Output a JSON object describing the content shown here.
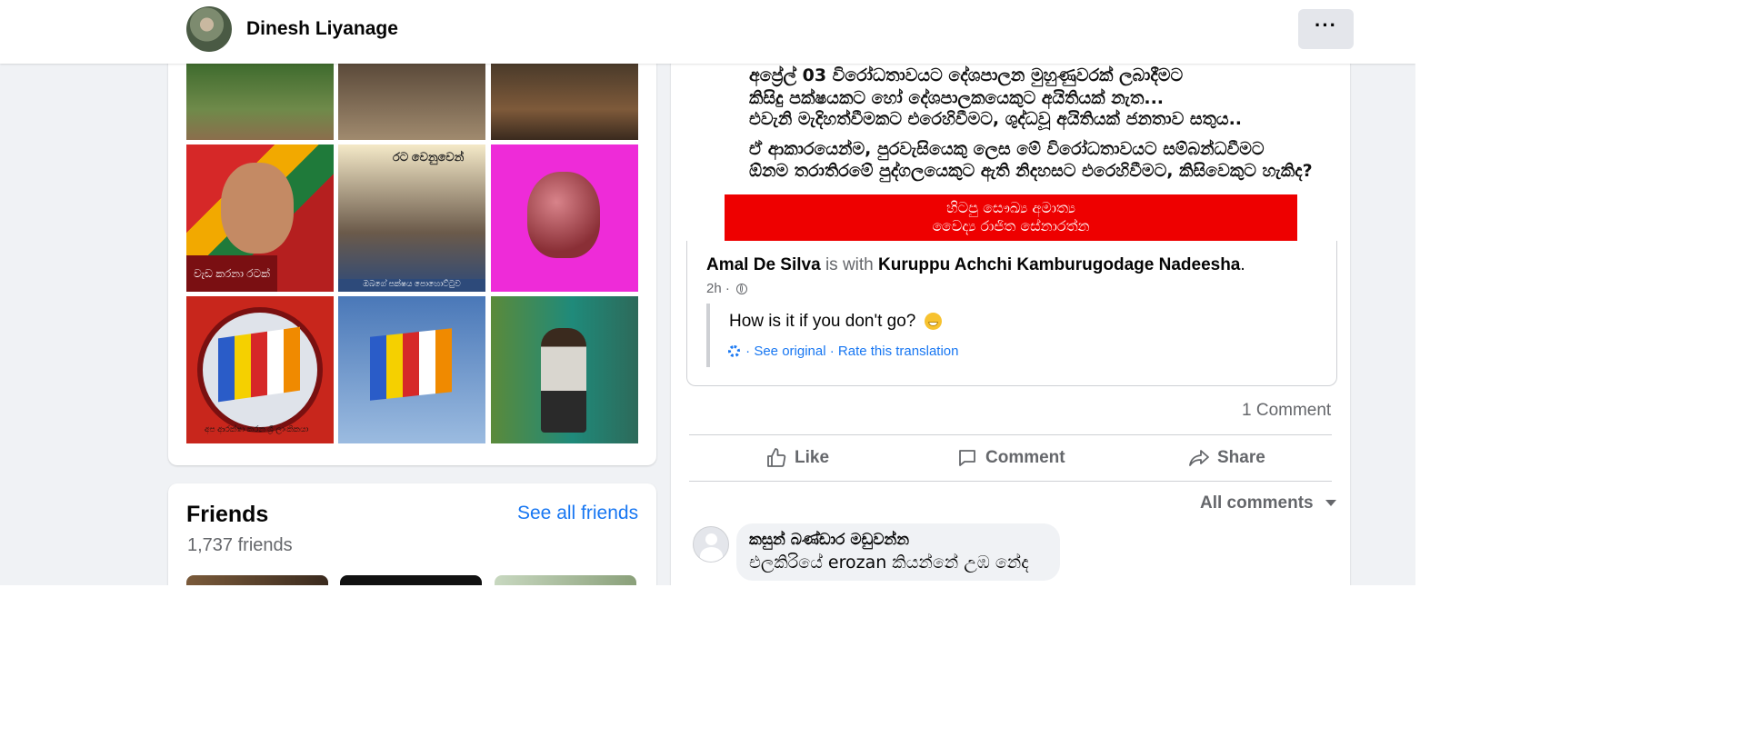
{
  "header": {
    "profile_name": "Dinesh Liyanage",
    "more_label": "···"
  },
  "photos": {
    "items": [
      {
        "description": "people in garden"
      },
      {
        "description": "man standing by roots"
      },
      {
        "description": "man sitting on ground"
      },
      {
        "description": "political poster",
        "caption": "වැඩ කරනා රටක්"
      },
      {
        "description": "police and officials",
        "sign": "රට වෙනුවෙන්",
        "bottom": "ඔබගේ පක්ෂය පොහොට්ටුව"
      },
      {
        "description": "heart in hand on pink"
      },
      {
        "description": "buddhist flag emblem",
        "ring_text": "අප ආරක්ෂා කරන ශ්‍රී ලාංකිකයා"
      },
      {
        "description": "buddhist flag against sky"
      },
      {
        "description": "man standing at door"
      }
    ]
  },
  "friends": {
    "title": "Friends",
    "see_all": "See all friends",
    "count": "1,737 friends"
  },
  "post": {
    "image_lines": [
      "අප්‍රේල් 03 විරෝධතාවයට දේශපාලන මුහුණුවරක් ලබාදීමට",
      "කිසිදු පක්ෂයකට හෝ දේශපාලකයෙකුට අයිතියක් නැත...",
      "එවැනි මැදිහත්වීමකට එරෙහිවීමට, ශුද්ධවූ අයිතියක් ජනතාව සතුය..",
      "ඒ ආකාරයෙන්ම, පුරවැසියෙකු ලෙස මේ විරෝධතාවයට සම්බන්ධවීමට",
      "ඕනම තරාතිරමේ පුද්ගලයෙකුට ඇති නිදහසට එරෙහිවීමට, කිසිවෙකුට හැකිද?"
    ],
    "banner_line_1": "හිටපු සෞඛ්‍ය අමාත්‍ය",
    "banner_line_2": "වෛද්‍ය රාජිත සේනාරත්න",
    "shared_author": "Amal De Silva",
    "shared_is_with": "is with",
    "shared_tagged": "Kuruppu Achchi Kamburugodage Nadeesha",
    "shared_period": ".",
    "time": "2h ·",
    "quote": "How is it if you don't go?",
    "see_original": "· See original",
    "rate_translation": "· Rate this translation",
    "comment_count": "1 Comment",
    "actions": {
      "like": "Like",
      "comment": "Comment",
      "share": "Share"
    },
    "all_comments": "All comments"
  },
  "comment": {
    "author": "කසුන් බණ්ඩාර මඩුවන්න",
    "text": "එලකිරියේ erozan කියන්නේ උඹ නේද"
  },
  "colors": {
    "accent": "#1877f2",
    "page_bg": "#f0f2f5",
    "muted_text": "#65676b",
    "banner_red": "#ee0000"
  },
  "icons": [
    "more-icon",
    "globe-icon",
    "laughing-emoji-icon",
    "gear-icon",
    "thumbs-up-icon",
    "comment-icon",
    "share-icon",
    "caret-down-icon",
    "default-avatar-icon"
  ]
}
